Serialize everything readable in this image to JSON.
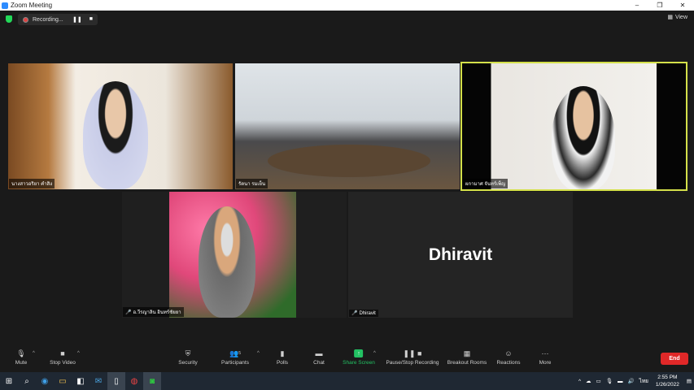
{
  "window": {
    "title": "Zoom Meeting",
    "buttons": [
      "–",
      "❐",
      "✕"
    ]
  },
  "top": {
    "recording_label": "Recording...",
    "view_label": "View"
  },
  "participants": [
    {
      "name": "นางสาวอริยา คำสิง"
    },
    {
      "name": "รัตนา รมเย็น"
    },
    {
      "name": "ผกามาศ จันทร์เพ็ญ"
    },
    {
      "name": "อ.วีรญาลิน อินทร์ชัยยา"
    },
    {
      "name": "Dhiravit",
      "display_big": "Dhiravit"
    }
  ],
  "toolbar": {
    "mute": "Mute",
    "stop_video": "Stop Video",
    "security": "Security",
    "participants": "Participants",
    "participants_count": "5",
    "polls": "Polls",
    "chat": "Chat",
    "share_screen": "Share Screen",
    "pause_stop_recording": "Pause/Stop Recording",
    "breakout_rooms": "Breakout Rooms",
    "reactions": "Reactions",
    "more": "More",
    "end": "End"
  },
  "taskbar": {
    "language": "ไทย",
    "time": "2:55 PM",
    "date": "1/26/2022"
  },
  "colors": {
    "accent_green": "#23c163",
    "end_red": "#e02828",
    "active_speaker_border": "#d4e04a"
  }
}
